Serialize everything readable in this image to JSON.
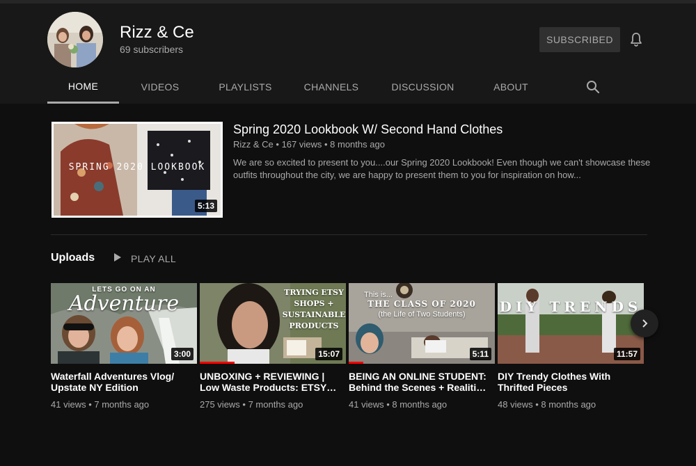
{
  "channel": {
    "name": "Rizz & Ce",
    "subscribers": "69 subscribers",
    "subscribe_label": "SUBSCRIBED"
  },
  "tabs": [
    {
      "label": "HOME"
    },
    {
      "label": "VIDEOS"
    },
    {
      "label": "PLAYLISTS"
    },
    {
      "label": "CHANNELS"
    },
    {
      "label": "DISCUSSION"
    },
    {
      "label": "ABOUT"
    }
  ],
  "featured": {
    "title": "Spring 2020 Lookbook W/ Second Hand Clothes",
    "meta": "Rizz & Ce • 167 views • 8 months ago",
    "description": "We are so excited to present to you....our Spring 2020 Lookbook! Even though we can't showcase these outfits throughout the city, we are happy to present them to you for inspiration on how...",
    "duration": "5:13",
    "thumb_text": "SPRING 2020 LOOKBOOK"
  },
  "uploads": {
    "title": "Uploads",
    "play_all": "PLAY ALL",
    "videos": [
      {
        "title": "Waterfall Adventures Vlog/ Upstate NY Edition",
        "meta": "41 views • 7 months ago",
        "duration": "3:00",
        "thumb_line1": "LETS GO ON AN",
        "thumb_line2": "Adventure",
        "progress": 0
      },
      {
        "title": "UNBOXING + REVIEWING | Low Waste Products: ETSY…",
        "meta": "275 views • 7 months ago",
        "duration": "15:07",
        "thumb_text": "TRYING ETSY SHOPS + SUSTAINABLE PRODUCTS",
        "progress": 0.24
      },
      {
        "title": "BEING AN ONLINE STUDENT: Behind the Scenes + Realiti…",
        "meta": "41 views • 8 months ago",
        "duration": "5:11",
        "thumb_line1": "This is...",
        "thumb_line2": "THE CLASS OF 2020",
        "thumb_line3": "(the Life of Two Students)",
        "progress": 0.1
      },
      {
        "title": "DIY Trendy Clothes With Thrifted Pieces",
        "meta": "48 views • 8 months ago",
        "duration": "11:57",
        "thumb_text": "DIY TRENDS",
        "progress": 0
      }
    ]
  },
  "icons": {
    "bell": "bell-icon",
    "search": "search-icon",
    "play": "play-icon",
    "next": "chevron-right-icon"
  }
}
